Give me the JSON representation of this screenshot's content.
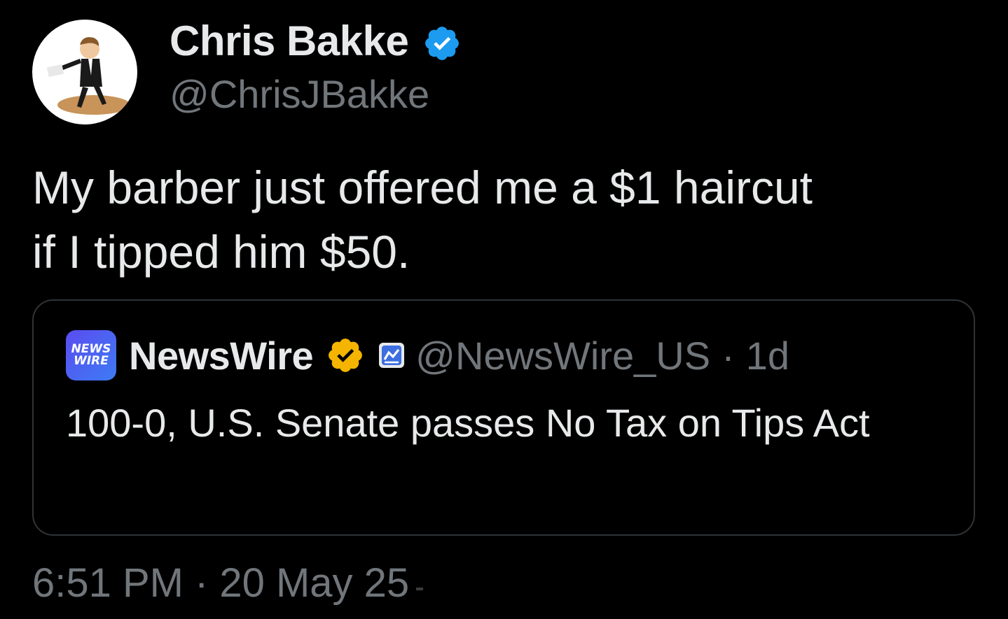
{
  "author": {
    "name": "Chris Bakke",
    "handle": "@ChrisJBakke",
    "verified_color": "#1d9bf0",
    "avatar_icon": "avatar-icon"
  },
  "tweet": {
    "text": "My barber just offered me a $1 haircut\nif I tipped him $50."
  },
  "quote": {
    "logo_line1": "NEWS",
    "logo_line2": "WIRE",
    "name": "NewsWire",
    "verified_color": "#f4b400",
    "handle": "@NewsWire_US",
    "separator": "·",
    "time": "1d",
    "text": "100-0, U.S. Senate passes No Tax on Tips Act"
  },
  "meta": {
    "time": "6:51 PM",
    "separator": "·",
    "date": "20 May 25"
  },
  "colors": {
    "background": "#000000",
    "primary_text": "#e7e9ea",
    "secondary_text": "#71767b",
    "border": "#2f3336"
  }
}
